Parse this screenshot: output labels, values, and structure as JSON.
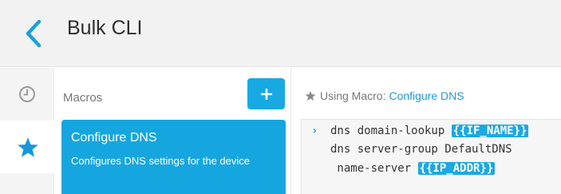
{
  "header": {
    "title": "Bulk CLI",
    "back_icon": "chevron-left-icon",
    "accent": "#1a9fdc"
  },
  "rail": {
    "items": [
      {
        "icon": "clock-icon",
        "label": "History",
        "selected": false
      },
      {
        "icon": "star-icon",
        "label": "Favorites",
        "selected": true
      }
    ]
  },
  "macros": {
    "heading": "Macros",
    "add_icon": "plus-icon",
    "items": [
      {
        "name": "Configure DNS",
        "description": "Configures DNS settings for the device",
        "selected": true
      }
    ]
  },
  "editor": {
    "using_label": "Using Macro:",
    "using_macro": "Configure DNS",
    "lines": [
      {
        "text": "dns domain-lookup ",
        "variable": "{{IF_NAME}}"
      },
      {
        "text": "dns server-group DefaultDNS",
        "variable": ""
      },
      {
        "text": " name-server ",
        "variable": "{{IP_ADDR}}"
      }
    ]
  },
  "colors": {
    "accent": "#17a9e1",
    "card": "#16a6df",
    "link": "#1f9ad6",
    "header_bg": "#f2f2f2"
  }
}
